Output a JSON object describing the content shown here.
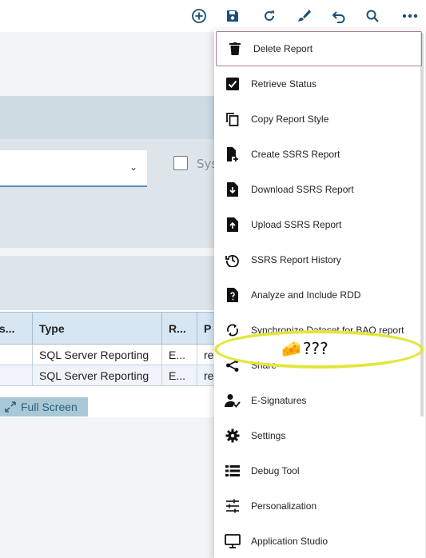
{
  "toolbar": {
    "buttons": [
      {
        "icon": "plus-circle-icon"
      },
      {
        "icon": "save-icon"
      },
      {
        "icon": "refresh-icon"
      },
      {
        "icon": "brush-icon"
      },
      {
        "icon": "undo-icon"
      },
      {
        "icon": "search-icon"
      },
      {
        "icon": "more-icon"
      }
    ]
  },
  "filter": {
    "select_value": "",
    "sys_checkbox_label": "Sys"
  },
  "grid": {
    "columns": [
      "s...",
      "Type",
      "R...",
      "P"
    ],
    "rows": [
      [
        "",
        "SQL Server Reporting",
        "E...",
        "re"
      ],
      [
        "",
        "SQL Server Reporting",
        "E...",
        "re"
      ]
    ]
  },
  "fullscreen_label": "Full Screen",
  "menu": {
    "items": [
      {
        "label": "Delete Report",
        "icon": "trash-icon"
      },
      {
        "label": "Retrieve Status",
        "icon": "checkbox-icon"
      },
      {
        "label": "Copy Report Style",
        "icon": "copy-icon"
      },
      {
        "label": "Create SSRS Report",
        "icon": "file-plus-icon"
      },
      {
        "label": "Download SSRS Report",
        "icon": "file-download-icon"
      },
      {
        "label": "Upload SSRS Report",
        "icon": "file-upload-icon"
      },
      {
        "label": "SSRS Report History",
        "icon": "history-icon"
      },
      {
        "label": "Analyze and Include RDD",
        "icon": "file-question-icon"
      },
      {
        "label": "Synchronize Dataset for BAQ report",
        "icon": "sync-icon"
      },
      {
        "label": "Share",
        "icon": "share-icon"
      },
      {
        "label": "E-Signatures",
        "icon": "signature-icon"
      },
      {
        "label": "Settings",
        "icon": "gear-icon"
      },
      {
        "label": "Debug Tool",
        "icon": "list-icon"
      },
      {
        "label": "Personalization",
        "icon": "sliders-icon"
      },
      {
        "label": "Application Studio",
        "icon": "monitor-icon"
      }
    ]
  },
  "annotation": {
    "emoji": "🧀",
    "text": "???"
  },
  "colors": {
    "toolbar_icon": "#1b4f7a",
    "menu_focus_border": "#b07a92",
    "annotation": "#e2e63a"
  }
}
